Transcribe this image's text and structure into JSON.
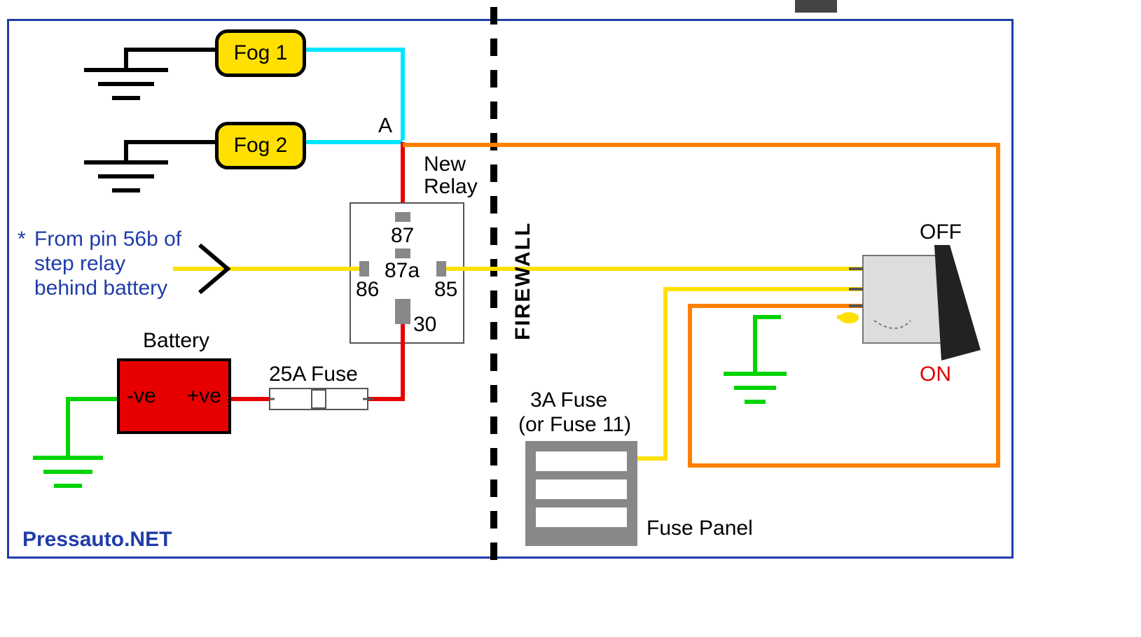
{
  "labels": {
    "fog1": "Fog 1",
    "fog2": "Fog 2",
    "a": "A",
    "new_relay_1": "New",
    "new_relay_2": "Relay",
    "pin87": "87",
    "pin87a": "87a",
    "pin86": "86",
    "pin85": "85",
    "pin30": "30",
    "battery": "Battery",
    "neg": "-ve",
    "pos": "+ve",
    "fuse25": "25A Fuse",
    "from_pin_1": "From pin 56b of",
    "from_pin_2": "step relay",
    "from_pin_3": "behind battery",
    "asterisk": "*",
    "firewall": "FIREWALL",
    "fuse3_1": "3A Fuse",
    "fuse3_2": "(or Fuse 11)",
    "fuse_panel": "Fuse Panel",
    "off": "OFF",
    "on": "ON",
    "credit": "Pressauto.NET"
  }
}
